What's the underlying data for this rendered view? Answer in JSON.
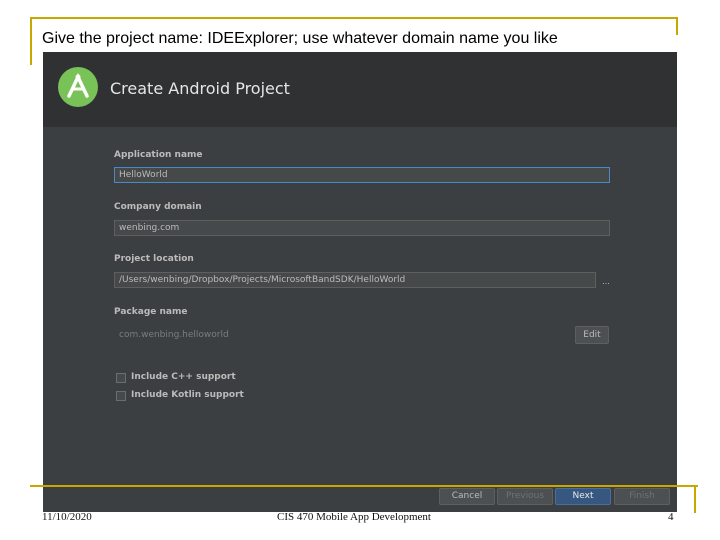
{
  "slide": {
    "title": "Give the project name: IDEExplorer; use whatever domain name you like",
    "footer_date": "11/10/2020",
    "footer_course": "CIS 470 Mobile App Development",
    "footer_page": "4",
    "accent_color": "#c8a800"
  },
  "dialog": {
    "title": "Create Android Project",
    "logo_icon": "android-studio-logo-icon",
    "fields": {
      "app_name_label": "Application name",
      "app_name_value": "HelloWorld",
      "company_domain_label": "Company domain",
      "company_domain_value": "wenbing.com",
      "project_location_label": "Project location",
      "project_location_value": "/Users/wenbing/Dropbox/Projects/MicrosoftBandSDK/HelloWorld",
      "browse_label": "...",
      "package_name_label": "Package name",
      "package_name_value": "com.wenbing.helloworld",
      "edit_label": "Edit"
    },
    "checkboxes": {
      "cpp_label": "Include C++ support",
      "kotlin_label": "Include Kotlin support"
    },
    "buttons": {
      "cancel": "Cancel",
      "previous": "Previous",
      "next": "Next",
      "finish": "Finish"
    },
    "colors": {
      "background": "#3c3f41",
      "header": "#2f3133",
      "primary_button": "#365880",
      "focus_border": "#4a88c7"
    }
  }
}
